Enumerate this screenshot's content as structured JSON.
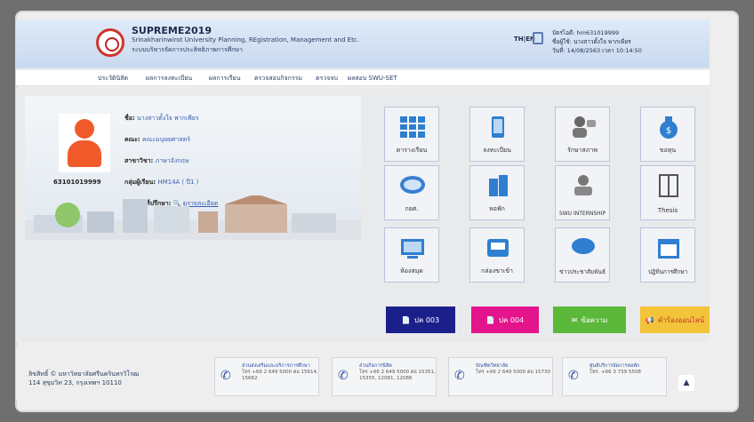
{
  "header": {
    "title": "SUPREME2019",
    "subtitle": "Srinakharinwirot University Planning, REgistration, Management and Etc.",
    "subtitle_th": "ระบบบริหารจัดการประสิทธิภาพการศึกษา",
    "lang": "TH|EN",
    "user_code": "บัตรไอดี: hm631019999",
    "user_name": "ชื่อผู้ใช้: นางสาวตั้งใจ พากเพียร",
    "datetime": "วันที่: 14/08/2563 เวลา 10:14:50"
  },
  "nav": {
    "items": [
      "ประวัตินิสิต",
      "ผลการลงทะเบียน",
      "ผลการเรียน",
      "ตรวจสอบกิจกรรม",
      "ตรวจจบ",
      "ผลสอบ SWU-SET"
    ]
  },
  "profile": {
    "student_id": "63101019999",
    "name_label": "ชื่อ:",
    "name": "นางสาวตั้งใจ พากเพียร",
    "faculty_label": "คณะ:",
    "faculty": "คณะมนุษยศาสตร์",
    "major_label": "สาขาวิชา:",
    "major": "ภาษาอังกฤษ",
    "group_label": "กลุ่มผู้เรียน:",
    "group": "HM14A ( ปี1 )",
    "advisor_label": "อาจารย์ที่ปรึกษา:",
    "advisor_link": "ดูรายละเอียด"
  },
  "tiles": [
    {
      "label": "ตารางเรียน",
      "icon": "table-icon"
    },
    {
      "label": "ลงทะเบียน",
      "icon": "phone-register-icon"
    },
    {
      "label": "รักษาสภาพ",
      "icon": "person-chat-icon"
    },
    {
      "label": "ขอทุน",
      "icon": "money-bag-icon"
    },
    {
      "label": "กยศ.",
      "icon": "student-loan-icon"
    },
    {
      "label": "หอพัก",
      "icon": "building-icon"
    },
    {
      "label": "SWU INTERNSHIP",
      "icon": "internship-icon"
    },
    {
      "label": "Thesis",
      "icon": "book-icon"
    },
    {
      "label": "ห้องสมุด",
      "icon": "library-icon"
    },
    {
      "label": "กล่องขาเข้า",
      "icon": "inbox-icon"
    },
    {
      "label": "ข่าวประชาสัมพันธ์",
      "icon": "chat-bubble-icon"
    },
    {
      "label": "ปฏิทินการศึกษา",
      "icon": "calendar-icon"
    }
  ],
  "buttons": [
    {
      "label": "ปค 003",
      "color": "#1b1f8a"
    },
    {
      "label": "ปค 004",
      "color": "#e4148c"
    },
    {
      "label": "ข้อความ",
      "color": "#5bb83a"
    },
    {
      "label": "คำร้องออนไลน์",
      "color": "#f3c43a"
    }
  ],
  "footer": {
    "copyright": "ลิขสิทธิ์ © มหาวิทยาลัยศรีนครินทรวิโรฒ",
    "address": "114 สุขุมวิท 23, กรุงเทพฯ 10110",
    "contacts": [
      {
        "title": "ส่วนส่งเสริมและบริการการศึกษา",
        "phone": "โทร +66 2 649 5000 ต่อ 15614, 15662"
      },
      {
        "title": "ส่วนกิจการนิสิต",
        "phone": "โทร +66 2 649 5000 ต่อ 15351, 15355, 12081, 12086"
      },
      {
        "title": "บัณฑิตวิทยาลัย",
        "phone": "โทร +66 2 649 5000 ต่อ 15730"
      },
      {
        "title": "ศูนย์บริการจัดการหอพัก",
        "phone": "โทร. +66 3 739 5508"
      }
    ]
  }
}
